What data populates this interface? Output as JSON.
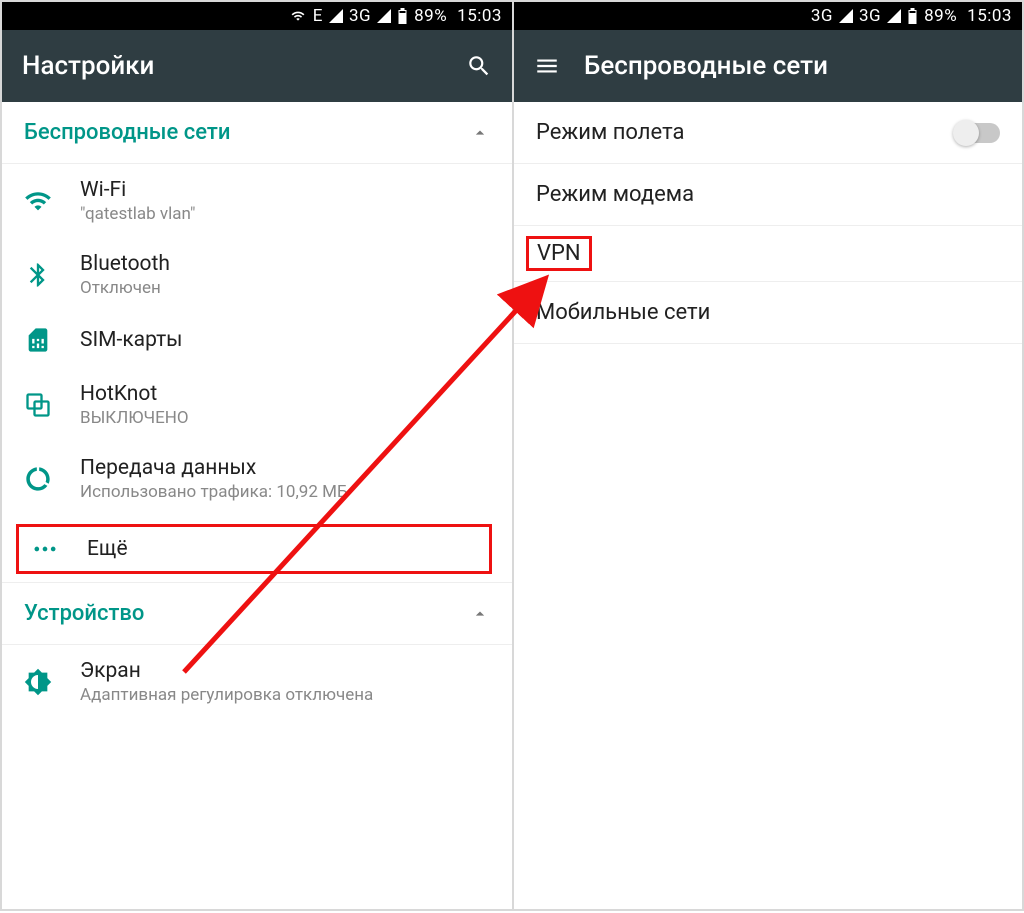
{
  "status": {
    "net1": "E",
    "net2": "3G",
    "net3": "3G",
    "net4": "3G",
    "battery": "89%",
    "time": "15:03"
  },
  "left": {
    "appbar_title": "Настройки",
    "section1": "Беспроводные сети",
    "wifi": {
      "title": "Wi-Fi",
      "sub": "\"qatestlab vlan\""
    },
    "bt": {
      "title": "Bluetooth",
      "sub": "Отключен"
    },
    "sim": {
      "title": "SIM-карты"
    },
    "hotknot": {
      "title": "HotKnot",
      "sub": "ВЫКЛЮЧЕНО"
    },
    "data": {
      "title": "Передача данных",
      "sub": "Использовано трафика: 10,92 МБ"
    },
    "more": {
      "title": "Ещё"
    },
    "section2": "Устройство",
    "display": {
      "title": "Экран",
      "sub": "Адаптивная регулировка отключена"
    }
  },
  "right": {
    "appbar_title": "Беспроводные сети",
    "airplane": "Режим полета",
    "tether": "Режим модема",
    "vpn": "VPN",
    "mobile": "Мобильные сети"
  }
}
